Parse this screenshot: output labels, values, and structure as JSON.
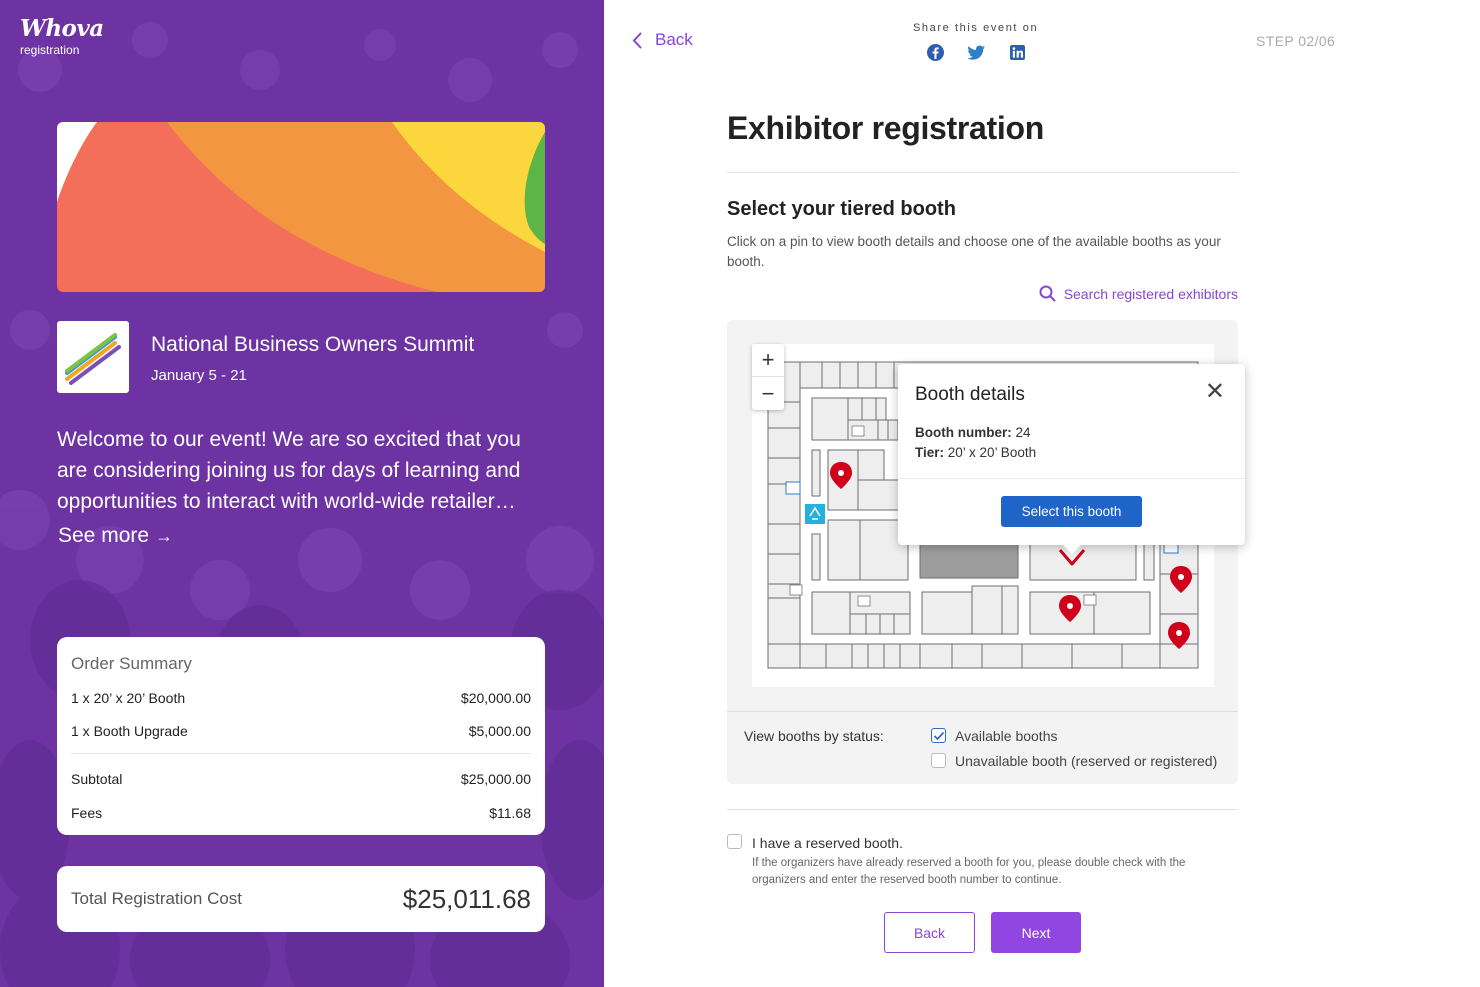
{
  "brand": {
    "logo_text": "Whova",
    "logo_subtext": "registration"
  },
  "event": {
    "title": "National Business Owners Summit",
    "dates": "January 5 - 21",
    "welcome": "Welcome to our event! We are so excited that you are considering joining us for days of learning and opportunities to interact with world-wide retailer…",
    "see_more": "See more",
    "see_more_arrow": "→"
  },
  "order_summary": {
    "title": "Order Summary",
    "items": [
      {
        "label": "1 x 20’ x 20’ Booth",
        "amount": "$20,000.00"
      },
      {
        "label": "1 x Booth Upgrade",
        "amount": "$5,000.00"
      }
    ],
    "subtotal_label": "Subtotal",
    "subtotal": "$25,000.00",
    "fees_label": "Fees",
    "fees": "$11.68"
  },
  "total": {
    "label": "Total Registration Cost",
    "amount": "$25,011.68"
  },
  "header": {
    "back_label": "Back",
    "share_label": "Share this event on",
    "share_icons": [
      "facebook-icon",
      "twitter-icon",
      "linkedin-icon"
    ],
    "step": "STEP 02/06"
  },
  "main": {
    "title": "Exhibitor registration",
    "section_title": "Select your tiered booth",
    "section_desc": "Click on a pin to view booth details and choose one of the available booths as your booth.",
    "search_link": "Search registered exhibitors"
  },
  "map": {
    "zoom_in": "+",
    "zoom_out": "−"
  },
  "popup": {
    "title": "Booth details",
    "close": "✕",
    "booth_number_label": "Booth number:",
    "booth_number": "24",
    "tier_label": "Tier:",
    "tier": "20’ x 20’ Booth",
    "select_label": "Select this booth"
  },
  "status_filter": {
    "label": "View booths by status:",
    "options": [
      {
        "label": "Available booths",
        "checked": true
      },
      {
        "label": "Unavailable booth (reserved or registered)",
        "checked": false
      }
    ]
  },
  "reserved": {
    "label": "I have a reserved booth.",
    "checked": false,
    "help": "If the organizers have already reserved a booth for you, please double check with the organizers and enter the reserved booth number to continue."
  },
  "footer": {
    "back_label": "Back",
    "next_label": "Next"
  },
  "colors": {
    "purple_panel": "#6d33a3",
    "accent_purple": "#8a44d6",
    "select_blue": "#1f64c8",
    "pin_red": "#d0021b"
  }
}
